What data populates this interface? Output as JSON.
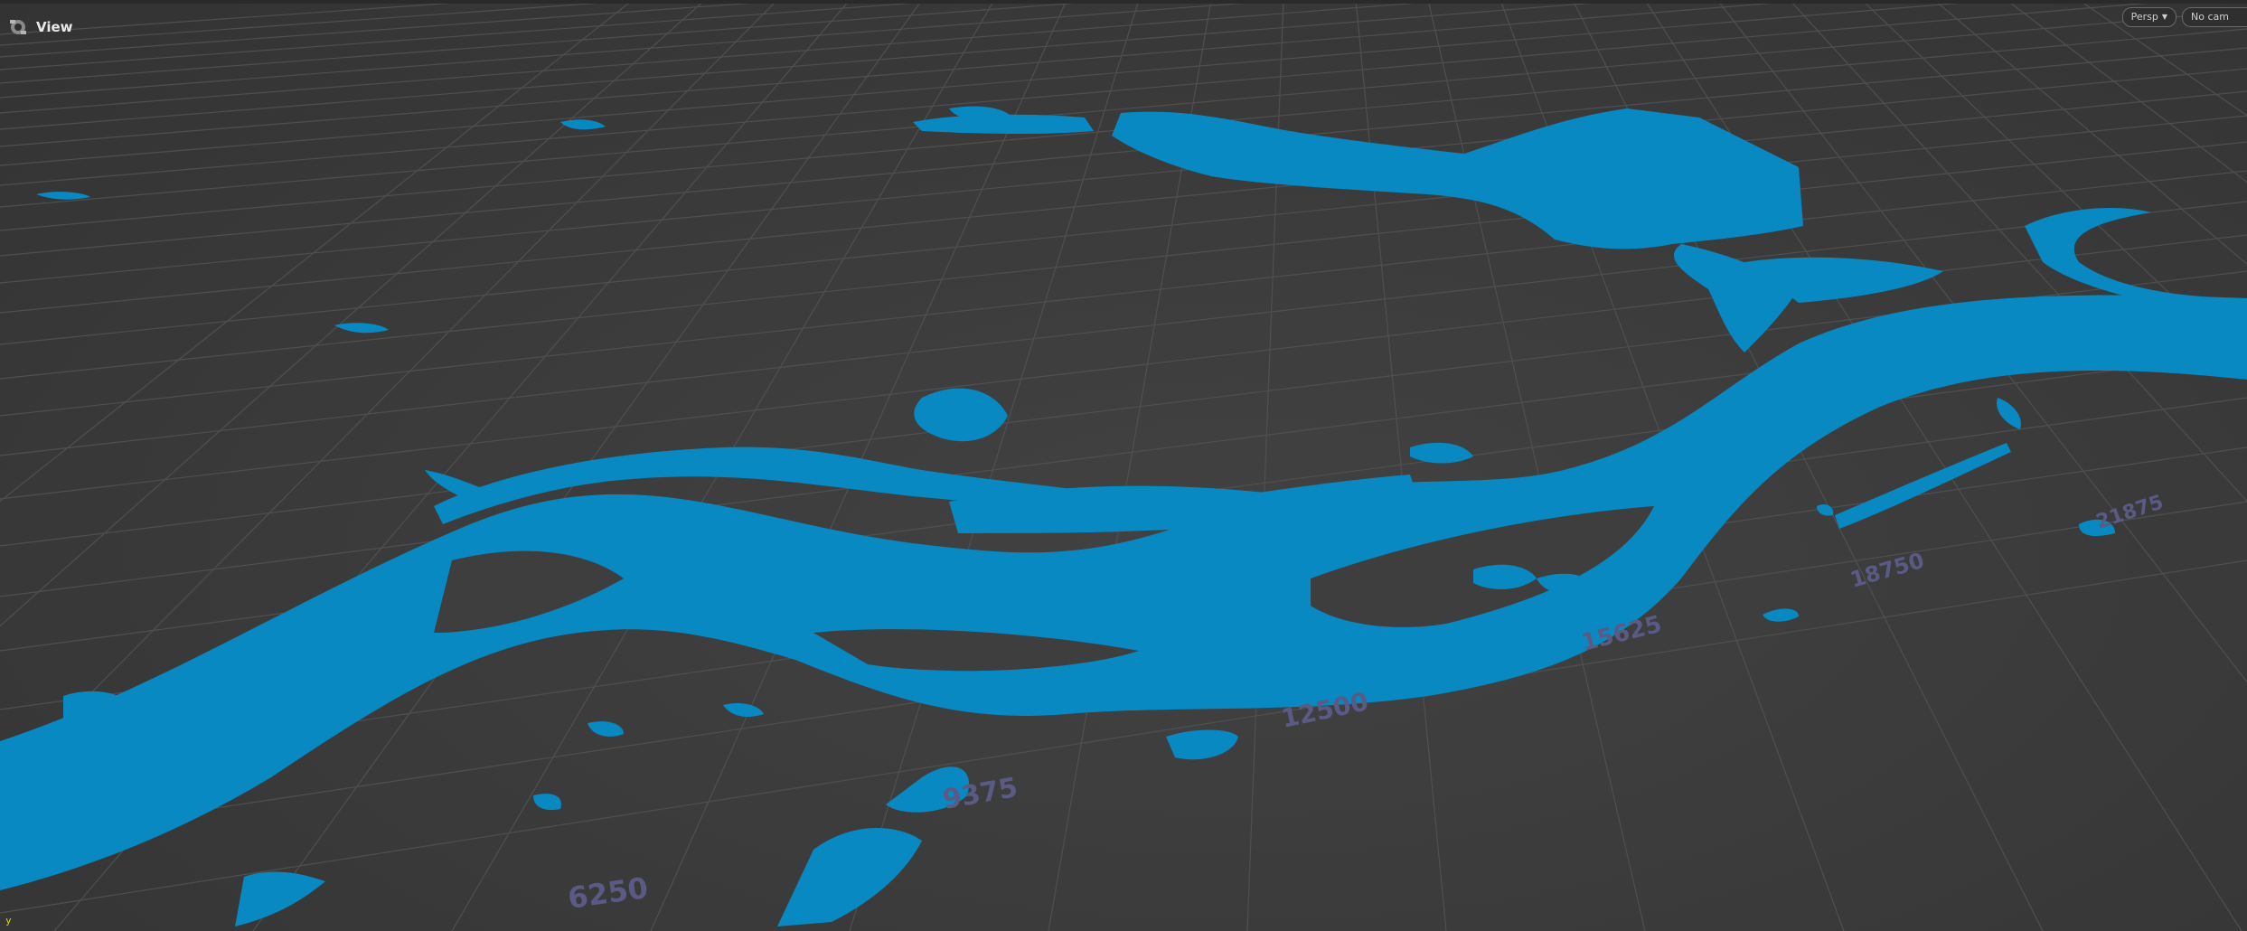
{
  "viewer": {
    "title": "View",
    "view_icon": "camera-icon",
    "projection_label": "Persp",
    "camera_label": "No cam",
    "axis_indicator": "y"
  },
  "rulers": [
    "6250",
    "9375",
    "12500",
    "15625",
    "18750",
    "21875"
  ],
  "colors": {
    "background": "#3b3b3b",
    "grid_line": "#525252",
    "water": "#0889c1",
    "ruler_text": "#5a5a85",
    "axis_y": "#d7d700"
  }
}
